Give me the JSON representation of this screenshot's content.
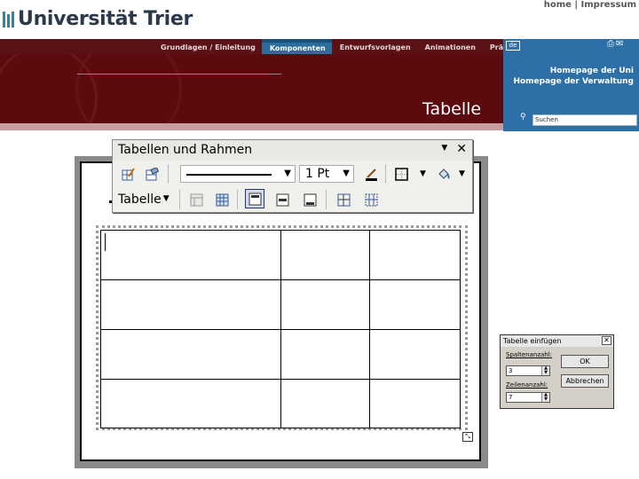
{
  "header": {
    "logo_text": "Universität Trier",
    "top_links": {
      "home": "home",
      "separator": "|",
      "impressum": "Impressum"
    },
    "nav": [
      {
        "label": "Grundlagen / Einleitung",
        "active": false
      },
      {
        "label": "Komponenten",
        "active": true
      },
      {
        "label": "Entwurfsvorlagen",
        "active": false
      },
      {
        "label": "Animationen",
        "active": false
      },
      {
        "label": "Präsentieren",
        "active": false
      }
    ],
    "banner_title": "Tabelle",
    "lang": "de",
    "right_links": [
      "Homepage der Uni",
      "Homepage der Verwaltung"
    ],
    "search_placeholder": "Suchen",
    "colors": {
      "banner": "#5d0a0e",
      "nav": "#5b1216",
      "accent": "#2d70a8"
    }
  },
  "toolbar": {
    "title": "Tabellen und Rahmen",
    "line_weight": "1 Pt",
    "table_menu": "Tabelle",
    "icons": [
      "draw-table-icon",
      "eraser-icon",
      "line-style-dropdown",
      "line-weight-dropdown",
      "border-color-icon",
      "outside-border-icon",
      "shading-color-icon",
      "merge-cells-icon",
      "split-cells-icon",
      "align-top-icon",
      "align-center-icon",
      "align-bottom-icon",
      "distribute-columns-icon",
      "distribute-rows-icon"
    ]
  },
  "table": {
    "rows": 4,
    "columns": 3
  },
  "dialog": {
    "title": "Tabelle einfügen",
    "columns_label": "Spaltenanzahl:",
    "columns_value": "3",
    "rows_label": "Zeilenanzahl:",
    "rows_value": "7",
    "ok_label": "OK",
    "cancel_label": "Abbrechen"
  }
}
